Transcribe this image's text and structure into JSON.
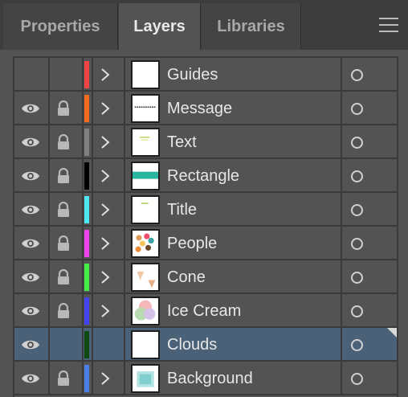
{
  "tabs": [
    {
      "label": "Properties",
      "active": false
    },
    {
      "label": "Layers",
      "active": true
    },
    {
      "label": "Libraries",
      "active": false
    }
  ],
  "layers": [
    {
      "name": "Guides",
      "color": "#ee4444",
      "visible": false,
      "locked": false,
      "expandable": true,
      "selected": false,
      "thumb": "blank"
    },
    {
      "name": "Message",
      "color": "#f26b21",
      "visible": true,
      "locked": true,
      "expandable": true,
      "selected": false,
      "thumb": "dash-line"
    },
    {
      "name": "Text",
      "color": "#808080",
      "visible": true,
      "locked": true,
      "expandable": true,
      "selected": false,
      "thumb": "text-speck"
    },
    {
      "name": "Rectangle",
      "color": "#000000",
      "visible": true,
      "locked": true,
      "expandable": true,
      "selected": false,
      "thumb": "teal-band"
    },
    {
      "name": "Title",
      "color": "#4ee6f0",
      "visible": true,
      "locked": true,
      "expandable": true,
      "selected": false,
      "thumb": "title-speck"
    },
    {
      "name": "People",
      "color": "#ee44ee",
      "visible": true,
      "locked": true,
      "expandable": true,
      "selected": false,
      "thumb": "people"
    },
    {
      "name": "Cone",
      "color": "#44ee44",
      "visible": true,
      "locked": true,
      "expandable": true,
      "selected": false,
      "thumb": "cones"
    },
    {
      "name": "Ice Cream",
      "color": "#4444ee",
      "visible": true,
      "locked": true,
      "expandable": true,
      "selected": false,
      "thumb": "scoops"
    },
    {
      "name": "Clouds",
      "color": "#0f4a14",
      "visible": true,
      "locked": false,
      "expandable": false,
      "selected": true,
      "thumb": "blank"
    },
    {
      "name": "Background",
      "color": "#4a7de8",
      "visible": true,
      "locked": true,
      "expandable": true,
      "selected": false,
      "thumb": "background"
    }
  ]
}
